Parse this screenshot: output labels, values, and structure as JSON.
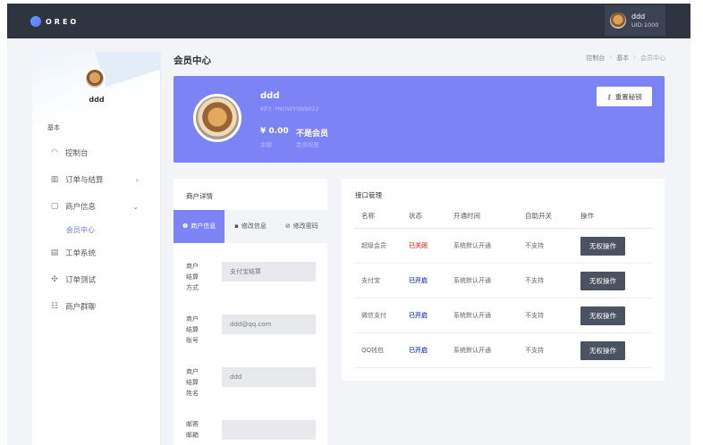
{
  "topbar": {
    "logo_text": "OREO",
    "user_name": "ddd",
    "user_uid": "UID:1000"
  },
  "sidebar": {
    "user_name": "ddd",
    "section_label": "基本",
    "items": [
      {
        "label": "控制台",
        "icon": "dashboard-icon"
      },
      {
        "label": "订单与结算",
        "icon": "grid-icon",
        "arrow": "›"
      },
      {
        "label": "商户信息",
        "icon": "document-icon",
        "arrow": "⌄"
      },
      {
        "label": "工单系统",
        "icon": "ticket-icon"
      },
      {
        "label": "订单测试",
        "icon": "test-icon"
      },
      {
        "label": "商户群聊",
        "icon": "group-icon"
      }
    ],
    "sub_item": "会员中心"
  },
  "header": {
    "title": "会员中心",
    "breadcrumb": [
      "控制台",
      "基本",
      "会员中心"
    ]
  },
  "profile": {
    "name": "ddd",
    "key": "KEY: YNOWY9N9022",
    "balance": "¥ 0.00",
    "balance_label": "余额",
    "member_status": "不是会员",
    "member_label": "会员权限",
    "reset_button": "重置秘钥"
  },
  "merchant_detail": {
    "title": "商户详情",
    "tabs": [
      "商户信息",
      "修改信息",
      "修改密码"
    ],
    "fields": [
      {
        "label": "商户结算方式",
        "value": "支付宝结算"
      },
      {
        "label": "商户结算账号",
        "value": "ddd@qq.com"
      },
      {
        "label": "商户结算姓名",
        "value": "ddd"
      },
      {
        "label": "邮寄邮箱",
        "value": ""
      }
    ]
  },
  "api_management": {
    "title": "接口管理",
    "columns": [
      "名称",
      "状态",
      "开通时间",
      "自助开关",
      "操作"
    ],
    "rows": [
      {
        "name": "超级会员",
        "status": "已关闭",
        "status_color": "#e64a4a",
        "open_time": "系统默认开通",
        "self_switch": "不支持",
        "action": "无权操作"
      },
      {
        "name": "支付宝",
        "status": "已开启",
        "status_color": "#3c4cc2",
        "open_time": "系统默认开通",
        "self_switch": "不支持",
        "action": "无权操作"
      },
      {
        "name": "微信支付",
        "status": "已开启",
        "status_color": "#3c4cc2",
        "open_time": "系统默认开通",
        "self_switch": "不支持",
        "action": "无权操作"
      },
      {
        "name": "QQ钱包",
        "status": "已开启",
        "status_color": "#3c4cc2",
        "open_time": "系统默认开通",
        "self_switch": "不支持",
        "action": "无权操作"
      }
    ]
  },
  "colors": {
    "topbar": "#2e3440",
    "accent": "#7c83f5",
    "status_off": "#e64a4a",
    "status_on": "#3c4cc2"
  }
}
